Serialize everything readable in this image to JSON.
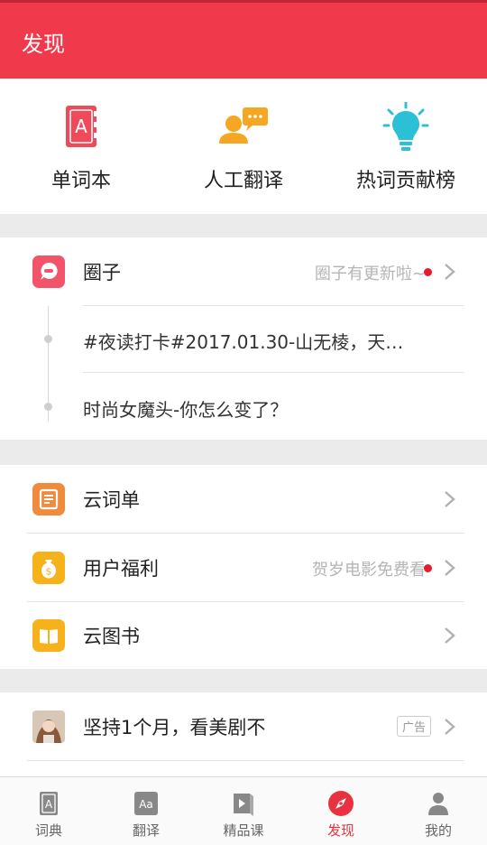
{
  "header": {
    "title": "发现"
  },
  "quick_actions": [
    {
      "label": "单词本",
      "icon": "wordbook-icon"
    },
    {
      "label": "人工翻译",
      "icon": "human-translate-icon"
    },
    {
      "label": "热词贡献榜",
      "icon": "lightbulb-icon"
    }
  ],
  "circle": {
    "label": "圈子",
    "hint": "圈子有更新啦~",
    "posts": [
      "#夜读打卡#2017.01.30-山无棱，天…",
      "时尚女魔头-你怎么变了？"
    ]
  },
  "menu": [
    {
      "label": "云词单",
      "hint": "",
      "icon": "word-list-icon",
      "color": "#f08a3c"
    },
    {
      "label": "用户福利",
      "hint": "贺岁电影免费看",
      "icon": "coin-bag-icon",
      "color": "#f5b21b"
    },
    {
      "label": "云图书",
      "icon": "book-icon",
      "color": "#f5b21b"
    }
  ],
  "ad": {
    "label": "坚持1个月，看美剧不",
    "tag": "广告"
  },
  "tabbar": [
    {
      "label": "词典",
      "icon": "dictionary-icon",
      "active": false
    },
    {
      "label": "翻译",
      "icon": "translate-icon",
      "active": false
    },
    {
      "label": "精品课",
      "icon": "course-icon",
      "active": false
    },
    {
      "label": "发现",
      "icon": "compass-icon",
      "active": true
    },
    {
      "label": "我的",
      "icon": "profile-icon",
      "active": false
    }
  ],
  "colors": {
    "brand": "#f0394a",
    "active_tab": "#e8323f",
    "notify_dot": "#e51c2c"
  }
}
